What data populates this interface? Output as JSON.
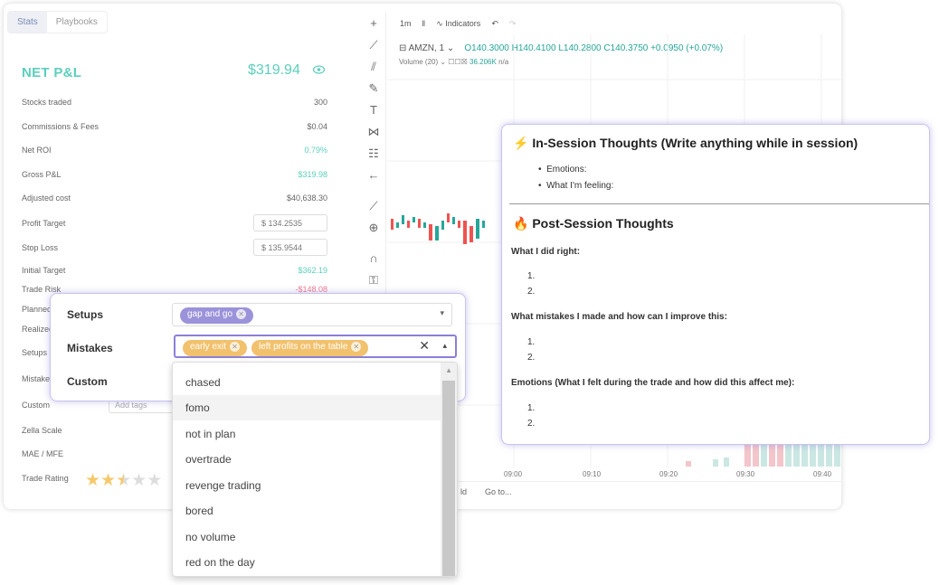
{
  "tabs": [
    "Stats",
    "Playbooks"
  ],
  "stats": {
    "net_label": "NET P&L",
    "net_value": "$319.94",
    "rows": [
      {
        "label": "Stocks traded",
        "value": "300"
      },
      {
        "label": "Commissions & Fees",
        "value": "$0.04"
      },
      {
        "label": "Net ROI",
        "value": "0.79%"
      },
      {
        "label": "Gross P&L",
        "value": "$319.98"
      },
      {
        "label": "Adjusted cost",
        "value": "$40,638.30"
      },
      {
        "label": "Profit Target",
        "value": "$  134.2535"
      },
      {
        "label": "Stop Loss",
        "value": "$  135.9544"
      },
      {
        "label": "Initial Target",
        "value": "$362.19"
      },
      {
        "label": "Trade Risk",
        "value": "-$148.08"
      },
      {
        "label": "Planned",
        "value": ""
      },
      {
        "label": "Realized",
        "value": ""
      },
      {
        "label": "Setups",
        "value": ""
      },
      {
        "label": "Mistakes",
        "value": ""
      },
      {
        "label": "Custom",
        "value": "Add tags"
      },
      {
        "label": "Zella Scale",
        "value": ""
      },
      {
        "label": "MAE / MFE",
        "value": ""
      },
      {
        "label": "Trade Rating",
        "value": ""
      }
    ],
    "rating": 2.5
  },
  "chart": {
    "interval": "1m",
    "indicators_label": "Indicators",
    "symbol_line": "AMZN, 1",
    "ohlc": "O140.3000  H140.4100  L140.2800  C140.3750  +0.0950 (+0.07%)",
    "volume_label": "Volume (20)",
    "volume_value": "36.206K",
    "volume_na": "n/a",
    "x_ticks": [
      "09:00",
      "09:10",
      "09:20",
      "09:30",
      "09:40"
    ],
    "goto": "Go to...",
    "bottom_left": "ld"
  },
  "popup": {
    "setups_label": "Setups",
    "mistakes_label": "Mistakes",
    "custom_label": "Custom",
    "setup_tags": [
      "gap and go"
    ],
    "mistake_tags": [
      "early exit",
      "left profits on the table"
    ]
  },
  "dropdown": {
    "options": [
      "chased",
      "fomo",
      "not in plan",
      "overtrade",
      "revenge trading",
      "bored",
      "no volume",
      "red on the day"
    ],
    "highlighted": "fomo"
  },
  "notes": {
    "in_session_title": "In-Session Thoughts (Write anything while in session)",
    "in_session_bullets": [
      "Emotions:",
      "What I'm feeling:"
    ],
    "post_title": "Post-Session Thoughts",
    "q1": "What I did right:",
    "q2": "What mistakes I made and how can I improve this:",
    "q3": "Emotions (What I felt during the trade and how did this affect me):",
    "numbers": [
      "1.",
      "2."
    ]
  },
  "colors": {
    "accent": "#5ccfbc",
    "purple": "#9b93da",
    "yellow": "#f2c16d",
    "negative": "#ef7d8b"
  }
}
